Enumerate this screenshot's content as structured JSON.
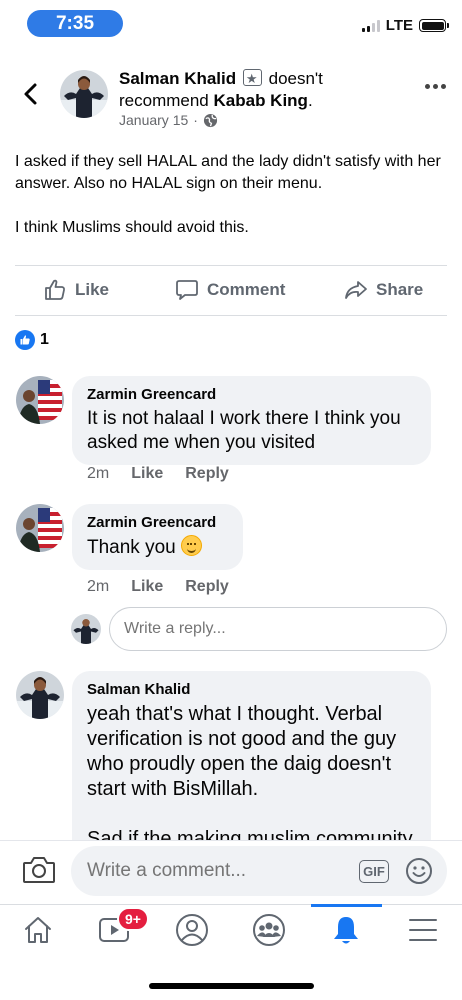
{
  "status_bar": {
    "time": "7:35",
    "network": "LTE"
  },
  "post": {
    "author": "Salman Khalid",
    "verb": "doesn't recommend",
    "business": "Kabab King",
    "date": "January 15",
    "paragraphs": [
      "I asked if they sell HALAL and the lady didn't satisfy with her answer. Also no HALAL sign on their menu.",
      "I think Muslims should avoid this."
    ],
    "actions": {
      "like": "Like",
      "comment": "Comment",
      "share": "Share"
    },
    "reaction_count": "1"
  },
  "comments": [
    {
      "author": "Zarmin Greencard",
      "text": "It is not halaal I work there I think you asked me when you visited",
      "time": "2m",
      "like": "Like",
      "reply": "Reply"
    },
    {
      "author": "Zarmin Greencard",
      "text": "Thank you",
      "time": "2m",
      "like": "Like",
      "reply": "Reply"
    },
    {
      "author": "Salman Khalid",
      "text": "yeah that's what I thought. Verbal verification is not good and the guy who proudly open the daig doesn't start with BisMillah.",
      "text_cut": "Sad if the making muslim community"
    }
  ],
  "reply_input": {
    "placeholder": "Write a reply..."
  },
  "comment_bar": {
    "placeholder": "Write a comment...",
    "gif": "GIF"
  },
  "tab_bar": {
    "video_badge": "9+"
  },
  "colors": {
    "accent": "#1877f2",
    "badge": "#e41e3f",
    "bubble": "#f0f2f5"
  }
}
